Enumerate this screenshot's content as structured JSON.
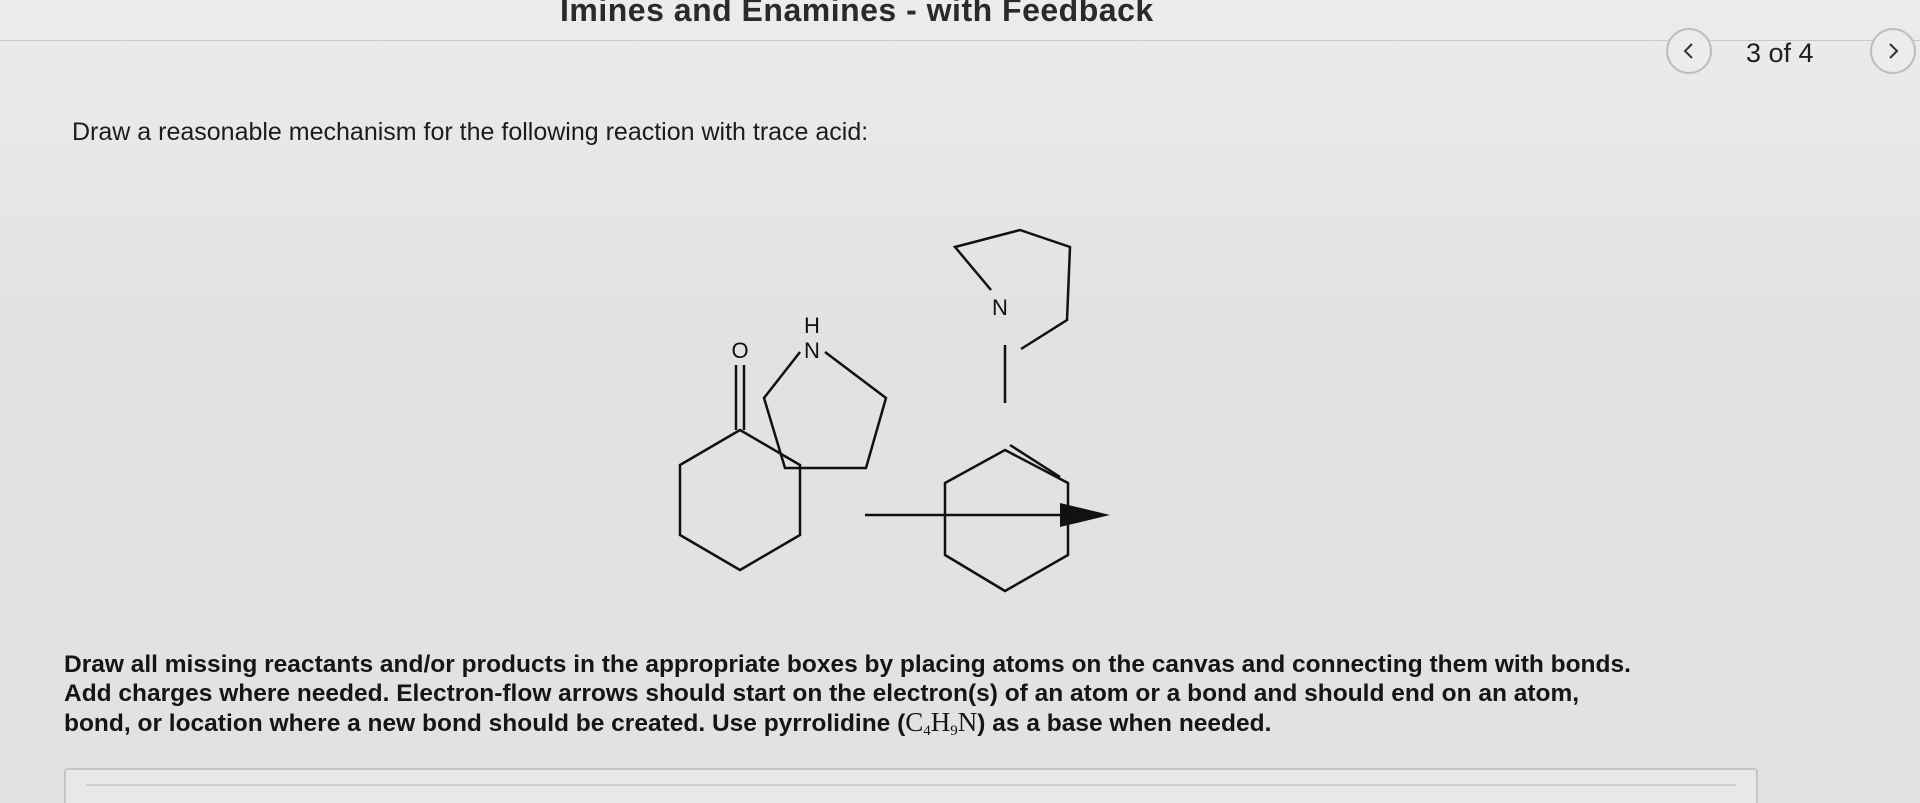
{
  "header": {
    "title": "Imines and Enamines - with Feedback"
  },
  "pager": {
    "page_label": "3 of 4",
    "prev_icon": "chevron-left-icon",
    "next_icon": "chevron-right-icon"
  },
  "question": {
    "prompt": "Draw a reasonable mechanism for the following reaction with trace acid:",
    "reaction": {
      "reactant_carbonyl_atom": "O",
      "reagent_amine_atom_h": "H",
      "reagent_amine_atom_n": "N",
      "product_amine_atom": "N"
    },
    "instructions": {
      "line1": "Draw all missing reactants and/or products in the appropriate boxes by placing atoms on the canvas and connecting them with bonds.",
      "line2": "Add charges where needed. Electron-flow arrows should start on the electron(s) of an atom or a bond and should end on an atom,",
      "line3_before": "bond, or location where a new bond should be created. Use pyrrolidine (",
      "formula_c": "C",
      "formula_c_sub": "4",
      "formula_h": "H",
      "formula_h_sub": "9",
      "formula_n": "N",
      "line3_after": ") as a base when needed."
    }
  },
  "colors": {
    "background": "#e2e2e0",
    "text": "#1a1a1a",
    "border": "#c6c6c4"
  }
}
